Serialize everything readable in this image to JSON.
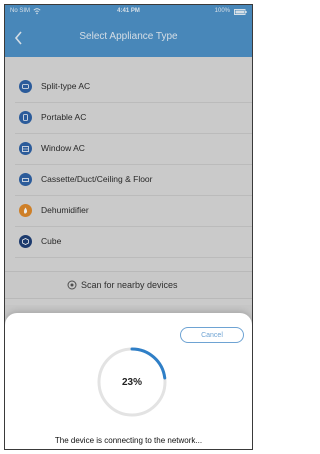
{
  "status_bar": {
    "carrier": "No SIM",
    "time": "4:41 PM",
    "battery": "100%"
  },
  "nav": {
    "back_icon": "chevron-left-icon",
    "title": "Select Appliance Type"
  },
  "appliances": [
    {
      "label": "Split-type AC",
      "icon": "split-ac-icon"
    },
    {
      "label": "Portable AC",
      "icon": "portable-ac-icon"
    },
    {
      "label": "Window AC",
      "icon": "window-ac-icon"
    },
    {
      "label": "Cassette/Duct/Ceiling & Floor",
      "icon": "cassette-ac-icon"
    },
    {
      "label": "Dehumidifier",
      "icon": "dehumidifier-icon"
    },
    {
      "label": "Cube",
      "icon": "cube-icon"
    }
  ],
  "scan": {
    "label": "Scan for nearby devices",
    "icon": "scan-icon"
  },
  "dialog": {
    "cancel_label": "Cancel",
    "progress_percent": 23,
    "progress_label": "23%",
    "message": "The device is connecting to the network..."
  },
  "colors": {
    "accent": "#4f93c9",
    "progress": "#2f7fc7",
    "track": "#e3e3e3"
  }
}
